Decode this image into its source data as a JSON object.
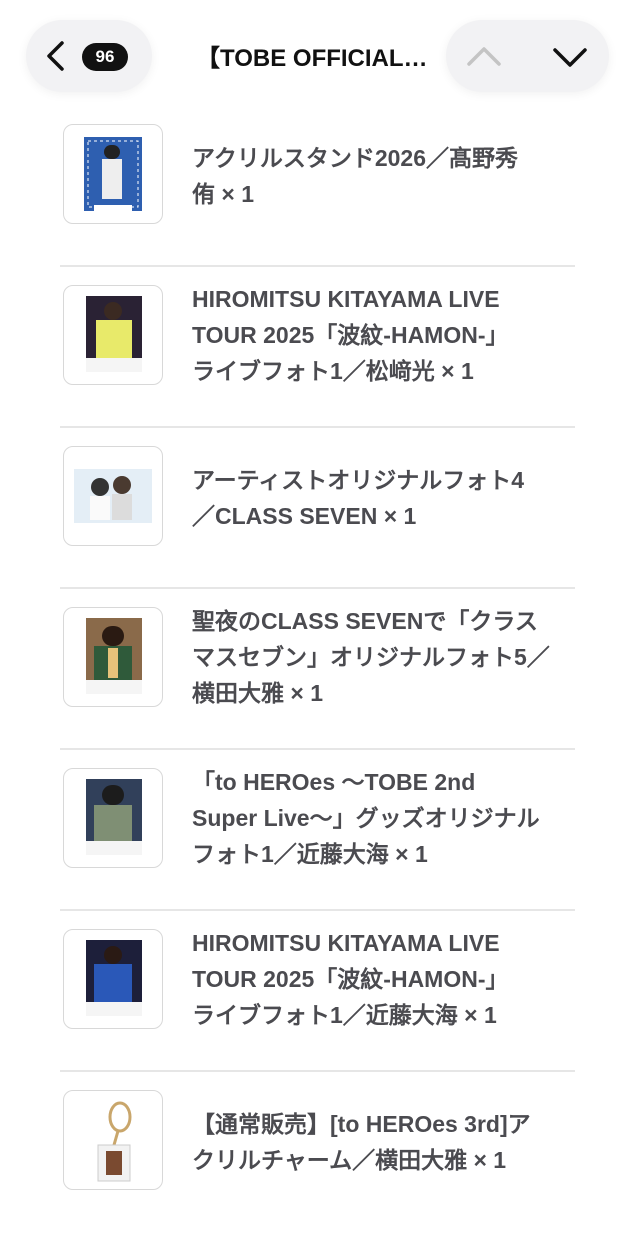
{
  "header": {
    "badge_count": "96",
    "title": "【TOBE OFFICIAL…",
    "back_icon": "chevron-left-icon",
    "prev_icon": "chevron-up-icon",
    "next_icon": "chevron-down-icon"
  },
  "items": [
    {
      "label": "アクリルスタンド2026／髙野秀\n侑 × 1"
    },
    {
      "label": "HIROMITSU KITAYAMA LIVE\nTOUR 2025「波紋-HAMON-」\nライブフォト1／松﨑光 × 1"
    },
    {
      "label": "アーティストオリジナルフォト4\n／CLASS SEVEN × 1"
    },
    {
      "label": "聖夜のCLASS SEVENで「クラス\nマスセブン」オリジナルフォト5／\n横田大雅 × 1"
    },
    {
      "label": "「to HEROes 〜TOBE 2nd\nSuper Live〜」グッズオリジナル\nフォト1／近藤大海 × 1"
    },
    {
      "label": "HIROMITSU KITAYAMA LIVE\nTOUR 2025「波紋-HAMON-」\nライブフォト1／近藤大海 × 1"
    },
    {
      "label": "【通常販売】[to HEROes 3rd]ア\nクリルチャーム／横田大雅 × 1"
    }
  ]
}
